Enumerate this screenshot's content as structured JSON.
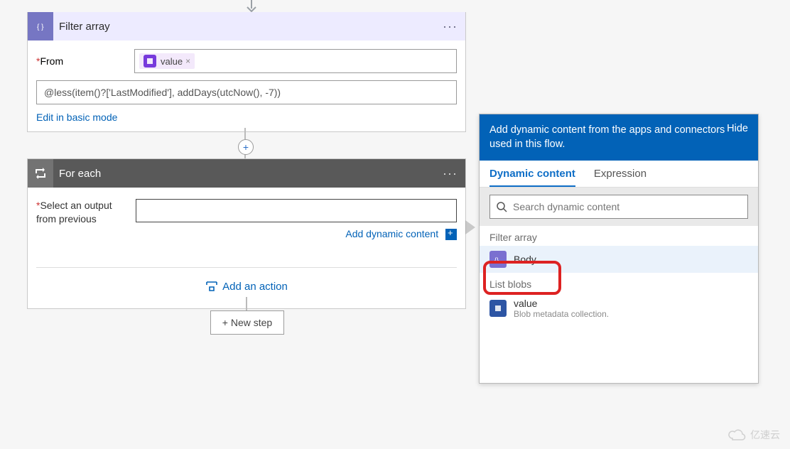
{
  "filter": {
    "title": "Filter array",
    "from_label": "From",
    "token_value": "value",
    "expression": "@less(item()?['LastModified'], addDays(utcNow(), -7))",
    "edit_link": "Edit in basic mode"
  },
  "foreach": {
    "title": "For each",
    "select_label_line1": "Select an output",
    "select_label_line2": "from previous",
    "input_value": "",
    "add_dynamic": "Add dynamic content",
    "add_action": "Add an action"
  },
  "newstep_label": "+ New step",
  "panel": {
    "heading": "Add dynamic content from the apps and connectors used in this flow.",
    "hide": "Hide",
    "tab_dynamic": "Dynamic content",
    "tab_expression": "Expression",
    "search_placeholder": "Search dynamic content",
    "sec_filter": "Filter array",
    "item_body": "Body",
    "sec_blobs": "List blobs",
    "item_value": "value",
    "item_value_sub": "Blob metadata collection."
  },
  "watermark": "亿速云"
}
